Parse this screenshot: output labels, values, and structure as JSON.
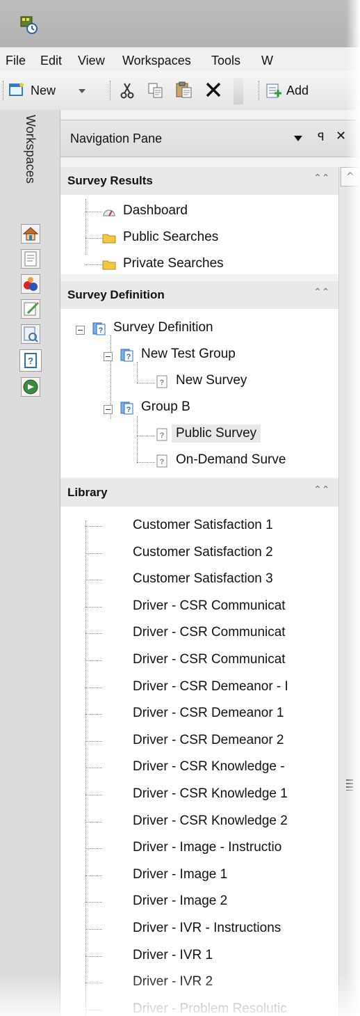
{
  "menu": [
    "File",
    "Edit",
    "View",
    "Workspaces",
    "Tools",
    "W"
  ],
  "toolbar": {
    "new_label": "New",
    "add_label": "Add",
    "icons": [
      "new-icon",
      "dropdown-arrow-icon",
      "cut-icon",
      "copy-icon",
      "paste-icon",
      "delete-icon",
      "add-icon"
    ]
  },
  "workspaces": {
    "label": "Workspaces",
    "buttons": [
      "home-icon",
      "document-icon",
      "people-icon",
      "edit-icon",
      "report-icon",
      "survey-icon",
      "navigate-icon"
    ]
  },
  "pane": {
    "title": "Navigation Pane",
    "sections": {
      "results": {
        "title": "Survey Results",
        "items": [
          "Dashboard",
          "Public Searches",
          "Private Searches"
        ]
      },
      "definition": {
        "title": "Survey Definition",
        "root": "Survey Definition",
        "groups": [
          {
            "name": "New Test Group",
            "surveys": [
              "New Survey"
            ]
          },
          {
            "name": "Group B",
            "surveys": [
              "Public Survey",
              "On-Demand Surve"
            ]
          }
        ]
      },
      "library": {
        "title": "Library",
        "items": [
          "Customer Satisfaction 1",
          "Customer Satisfaction 2",
          "Customer Satisfaction 3",
          "Driver - CSR Communicat",
          "Driver - CSR Communicat",
          "Driver - CSR Communicat",
          "Driver - CSR Demeanor - I",
          "Driver - CSR Demeanor 1",
          "Driver - CSR Demeanor 2",
          "Driver - CSR Knowledge -",
          "Driver - CSR Knowledge 1",
          "Driver - CSR Knowledge 2",
          "Driver - Image - Instructio",
          "Driver - Image 1",
          "Driver - Image 2",
          "Driver - IVR - Instructions",
          "Driver - IVR 1",
          "Driver - IVR 2",
          "Driver - Problem Resolutic"
        ]
      }
    }
  }
}
